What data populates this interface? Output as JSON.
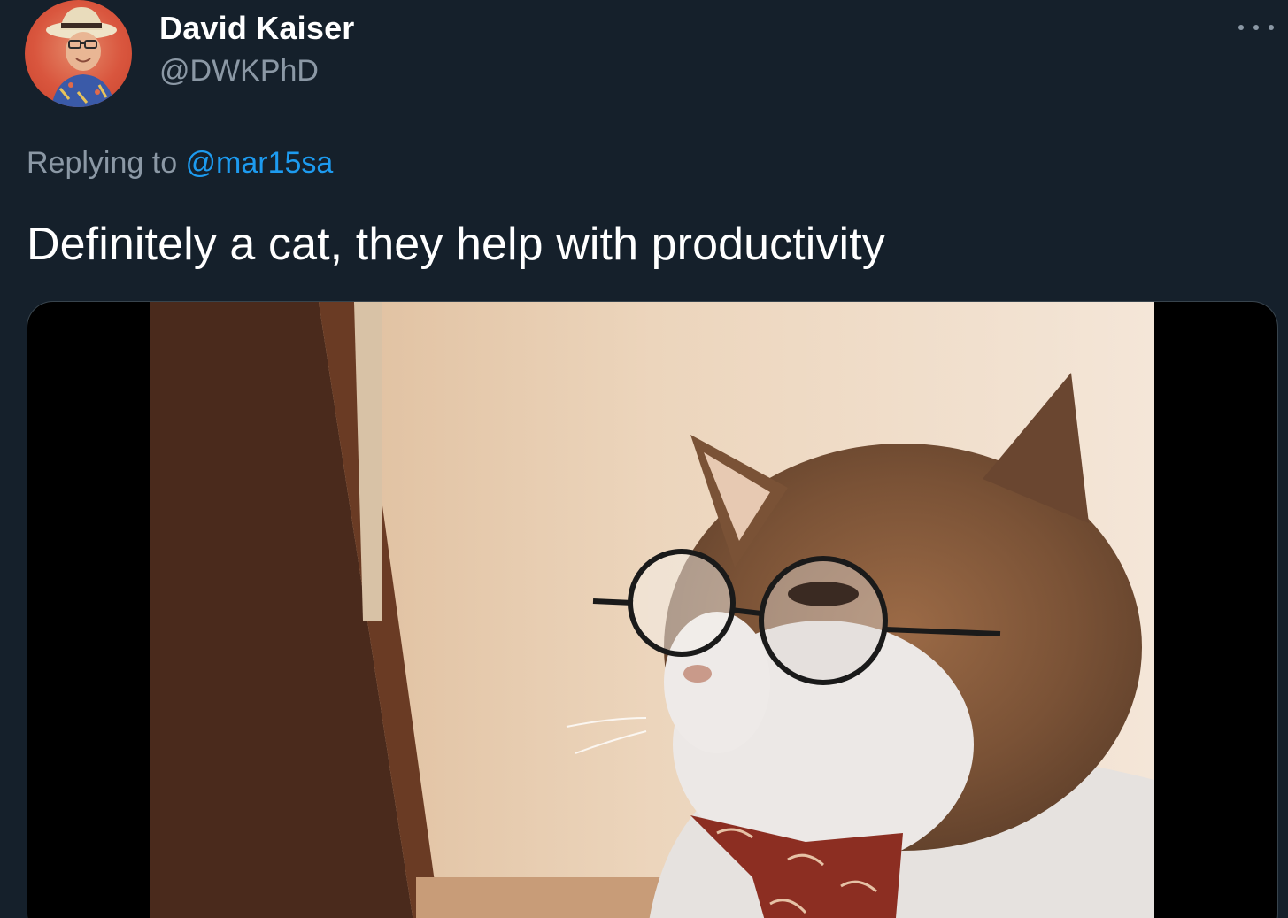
{
  "author": {
    "display_name": "David Kaiser",
    "handle": "@DWKPhD",
    "avatar_icon": "profile-photo"
  },
  "more_icon": "more-horizontal-icon",
  "reply": {
    "prefix": "Replying to ",
    "mention": "@mar15sa"
  },
  "tweet": {
    "text": "Definitely a cat, they help with productivity"
  },
  "media": {
    "type": "gif",
    "subject": "cat-with-glasses"
  },
  "colors": {
    "background": "#15202b",
    "secondary_text": "#8b98a5",
    "link": "#1d9bf0",
    "primary_text": "#ffffff"
  }
}
